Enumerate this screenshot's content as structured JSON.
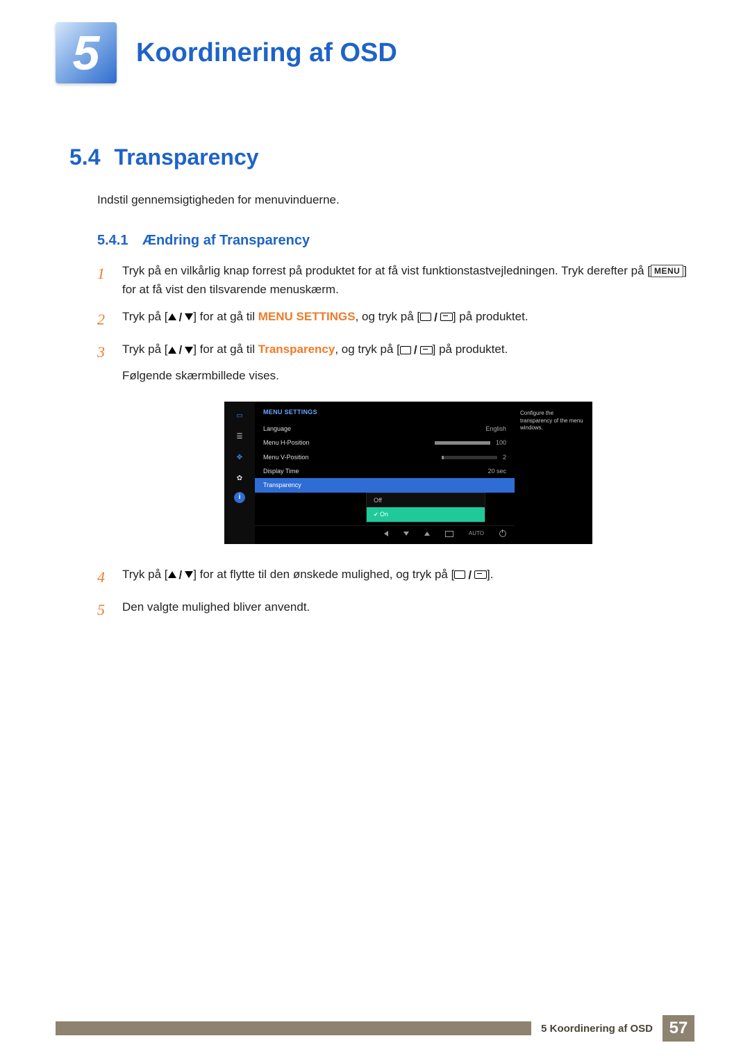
{
  "chapter": {
    "number": "5",
    "title": "Koordinering af OSD"
  },
  "section": {
    "number": "5.4",
    "title": "Transparency"
  },
  "intro": "Indstil gennemsigtigheden for menuvinduerne.",
  "subsection": {
    "number": "5.4.1",
    "title": "Ændring af Transparency"
  },
  "steps": {
    "s1a": "Tryk på en vilkårlig knap forrest på produktet for at få vist funktionstastvejledningen. Tryk derefter på ",
    "s1_menu": "MENU",
    "s1b": " for at få vist den tilsvarende menuskærm.",
    "s2a": "Tryk på [",
    "s2b": "] for at gå til ",
    "s2_menu": "MENU SETTINGS",
    "s2c": ", og tryk på [",
    "s2d": "] på produktet.",
    "s3a": "Tryk på [",
    "s3b": "] for at gå til ",
    "s3_target": "Transparency",
    "s3c": ", og tryk på [",
    "s3d": "] på produktet.",
    "s3_follow": "Følgende skærmbillede vises.",
    "s4a": "Tryk på [",
    "s4b": "] for at flytte til den ønskede mulighed, og tryk på [",
    "s4c": "].",
    "s5": "Den valgte mulighed bliver anvendt."
  },
  "step_numbers": {
    "n1": "1",
    "n2": "2",
    "n3": "3",
    "n4": "4",
    "n5": "5"
  },
  "osd": {
    "title": "MENU SETTINGS",
    "rows": {
      "language": {
        "label": "Language",
        "value": "English"
      },
      "hpos": {
        "label": "Menu H-Position",
        "value": "100"
      },
      "vpos": {
        "label": "Menu V-Position",
        "value": "2"
      },
      "dtime": {
        "label": "Display Time",
        "value": "20 sec"
      },
      "trans": {
        "label": "Transparency"
      }
    },
    "options": {
      "off": "Off",
      "on": "On"
    },
    "hint": "Configure the transparency of the menu windows.",
    "footer_auto": "AUTO"
  },
  "footer": {
    "label": "5 Koordinering af OSD",
    "page": "57"
  }
}
